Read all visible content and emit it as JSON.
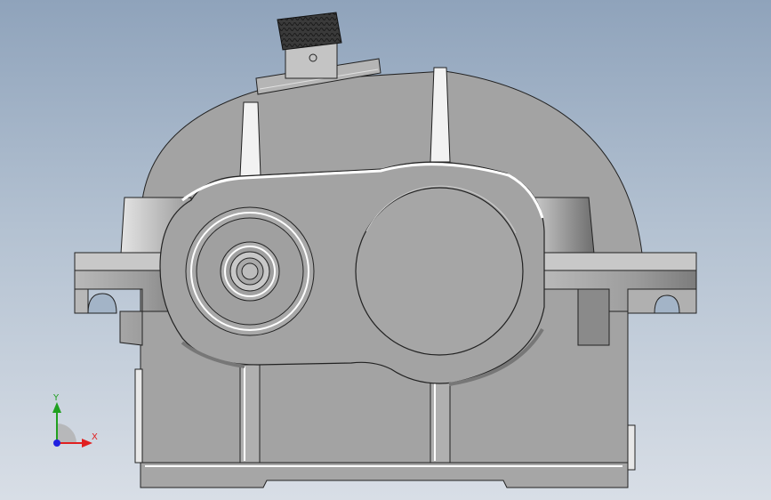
{
  "triad": {
    "x_label": "X",
    "y_label": "Y"
  },
  "colors": {
    "background_top": "#8fa3bb",
    "background_bottom": "#d8dee6",
    "body": "#a3a3a3",
    "body_dark": "#8e8e8e",
    "body_light": "#c6c6c6",
    "highlight": "#ffffff",
    "outline": "#222222",
    "axis_x": "#e02020",
    "axis_y": "#20a020",
    "axis_z": "#2020e0"
  }
}
